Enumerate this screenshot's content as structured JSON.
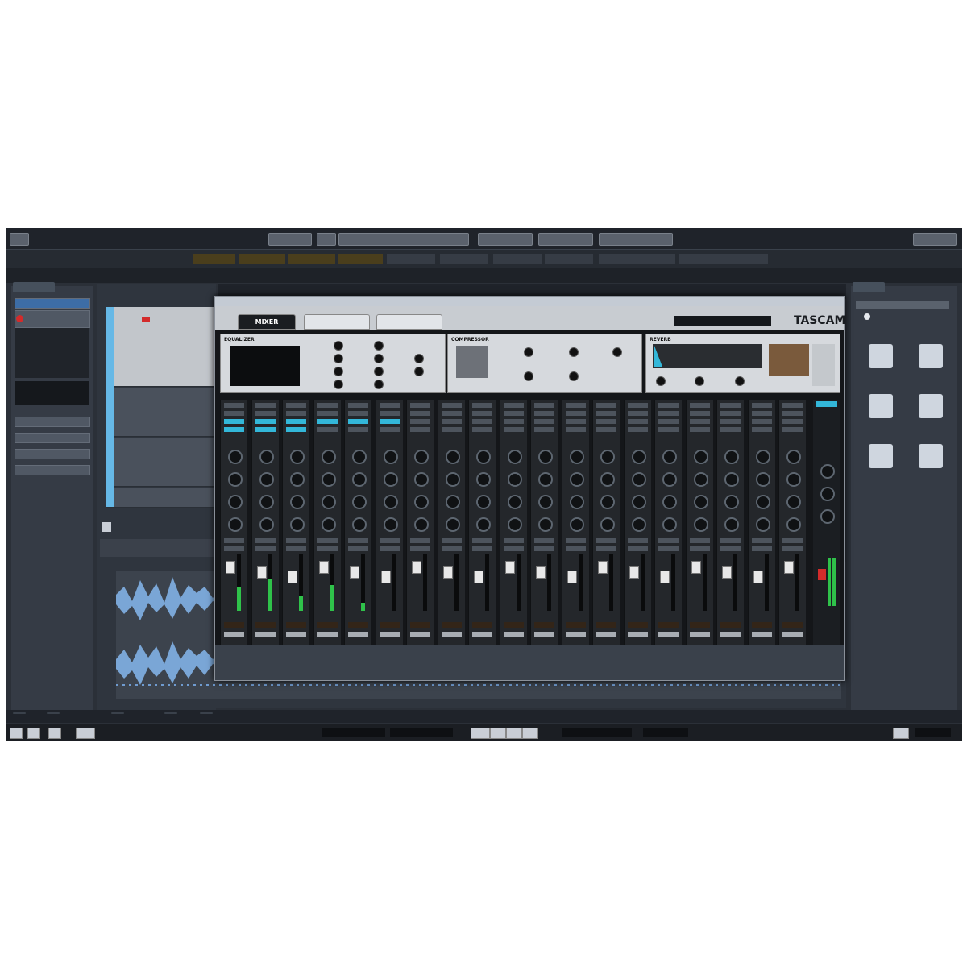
{
  "mixer_plugin": {
    "brand": "TASCAM",
    "tabs": [
      {
        "label": "MIXER",
        "active": true
      },
      {
        "label": "",
        "active": false
      },
      {
        "label": "",
        "active": false
      }
    ],
    "sections": {
      "equalizer": "EQUALIZER",
      "compressor": "COMPRESSOR",
      "reverb": "REVERB"
    },
    "channel_count": 19
  },
  "colors": {
    "accent_cyan": "#33b7d9",
    "meter_green": "#2fc24a",
    "value_orange": "#e19a2a",
    "app_bg": "#2b3038"
  },
  "icons": [
    "instruments-icon",
    "loops-icon",
    "presets-icon",
    "user-presets-icon",
    "favorites-icon",
    "file-browser-icon"
  ]
}
